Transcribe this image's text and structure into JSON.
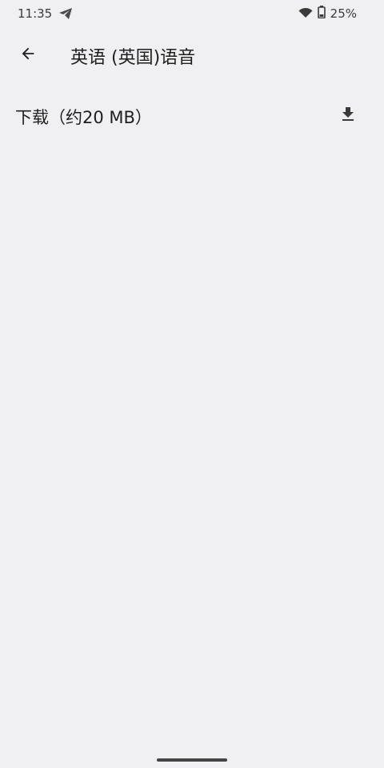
{
  "status_bar": {
    "time": "11:35",
    "battery_percent": "25%",
    "icons": [
      "telegram-icon",
      "wifi-icon",
      "battery-icon"
    ]
  },
  "app_bar": {
    "title": "英语 (英国)语音",
    "back_icon": "arrow-back-icon"
  },
  "download": {
    "label": "下载（约20 MB）",
    "icon": "download-icon"
  },
  "colors": {
    "background": "#f0f0f3",
    "text": "#1f1f1f",
    "icon": "#3a3a3a"
  }
}
